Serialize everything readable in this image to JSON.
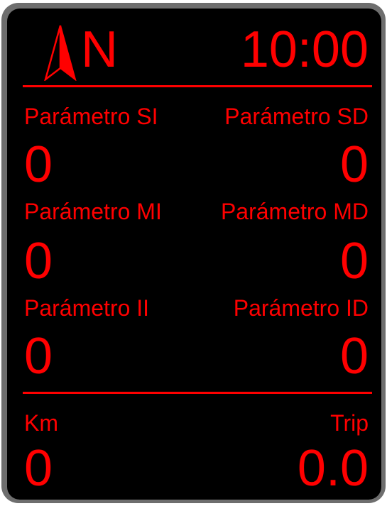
{
  "header": {
    "heading": "N",
    "time": "10:00"
  },
  "params": {
    "top_left": {
      "label": "Parámetro SI",
      "value": "0"
    },
    "top_right": {
      "label": "Parámetro SD",
      "value": "0"
    },
    "mid_left": {
      "label": "Parámetro MI",
      "value": "0"
    },
    "mid_right": {
      "label": "Parámetro MD",
      "value": "0"
    },
    "bottom_left": {
      "label": "Parámetro II",
      "value": "0"
    },
    "bottom_right": {
      "label": "Parámetro ID",
      "value": "0"
    }
  },
  "footer": {
    "km_label": "Km",
    "km_value": "0",
    "trip_label": "Trip",
    "trip_value": "0.0"
  },
  "colors": {
    "accent": "#ff0000",
    "background": "#000000",
    "bezel": "#6e6e6e"
  },
  "icons": {
    "compass": "compass-arrow-icon"
  }
}
